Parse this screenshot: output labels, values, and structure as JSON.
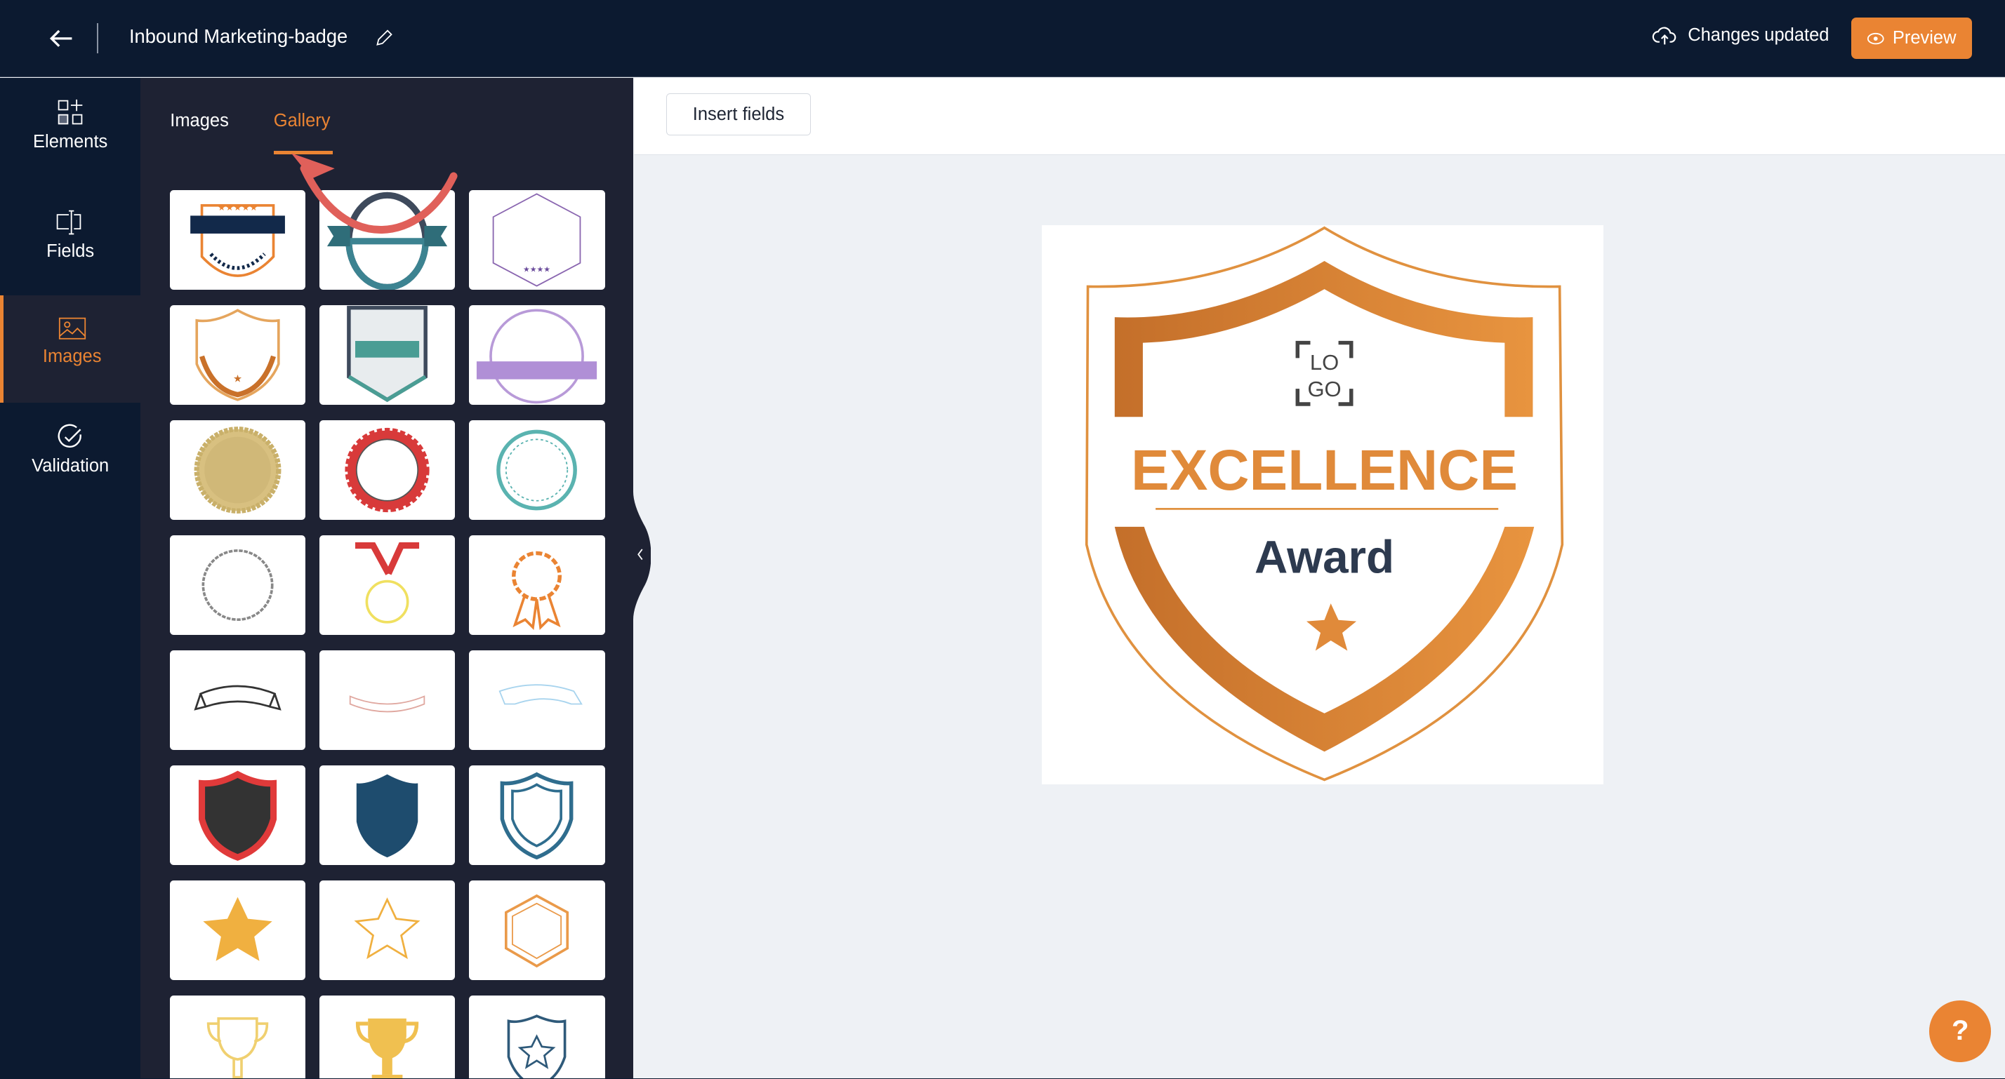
{
  "header": {
    "title": "Inbound Marketing-badge",
    "status": "Changes updated",
    "preview_label": "Preview"
  },
  "rail": {
    "items": [
      {
        "label": "Elements",
        "icon": "elements-icon"
      },
      {
        "label": "Fields",
        "icon": "fields-icon"
      },
      {
        "label": "Images",
        "icon": "image-icon",
        "active": true
      },
      {
        "label": "Validation",
        "icon": "check-circle-icon"
      }
    ]
  },
  "panel": {
    "tabs": [
      {
        "label": "Images"
      },
      {
        "label": "Gallery",
        "active": true
      }
    ],
    "gallery": [
      "emblem-laurel",
      "ring-ribbon",
      "hexagon-stars",
      "shield-orange",
      "shield-teal",
      "circle-ribbon-purple",
      "seal-gold",
      "seal-red",
      "circle-teal",
      "circle-gray",
      "medal-red",
      "rosette-orange",
      "banner-dark",
      "banner-pink",
      "banner-blue",
      "shield-red",
      "shield-navy",
      "shield-outline-blue",
      "star-filled",
      "star-outline",
      "hexagon-orange",
      "trophy-outline",
      "trophy-gold",
      "police-badge"
    ]
  },
  "toolbar": {
    "insert_fields": "Insert fields"
  },
  "badge": {
    "logo_top": "LO",
    "logo_bottom": "GO",
    "title": "EXCELLENCE",
    "subtitle": "Award"
  },
  "help": {
    "label": "?"
  },
  "colors": {
    "accent": "#ea8433",
    "header": "#0c1a30",
    "panel": "#1e2233"
  }
}
